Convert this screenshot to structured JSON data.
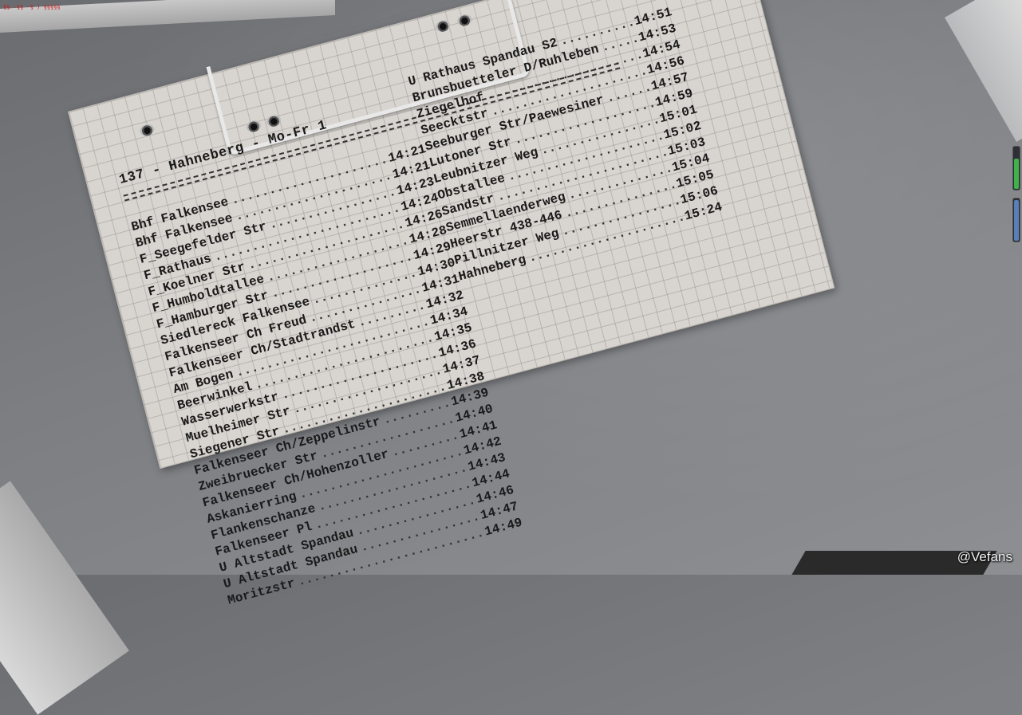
{
  "debug_text": "§§ -§§ -§ ) §§§§§",
  "watermark": "@Vefans",
  "timetable": {
    "header": "137 - Hahneberg - Mo-Fr 1",
    "left_stops": [
      {
        "name": "Bhf Falkensee",
        "time": "14:21"
      },
      {
        "name": "Bhf Falkensee",
        "time": "14:21"
      },
      {
        "name": "F_Seegefelder Str",
        "time": "14:23"
      },
      {
        "name": "F_Rathaus",
        "time": "14:24"
      },
      {
        "name": "F_Koelner Str",
        "time": "14:26"
      },
      {
        "name": "F_Humboldtallee",
        "time": "14:28"
      },
      {
        "name": "F_Hamburger Str",
        "time": "14:29"
      },
      {
        "name": "Siedlereck Falkensee",
        "time": "14:30"
      },
      {
        "name": "Falkenseer Ch Freud",
        "time": "14:31"
      },
      {
        "name": "Falkenseer Ch/Stadtrandst",
        "time": "14:32"
      },
      {
        "name": "Am Bogen",
        "time": "14:34"
      },
      {
        "name": "Beerwinkel",
        "time": "14:35"
      },
      {
        "name": "Wasserwerkstr",
        "time": "14:36"
      },
      {
        "name": "Muelheimer Str",
        "time": "14:37"
      },
      {
        "name": "Siegener Str",
        "time": "14:38"
      },
      {
        "name": "Falkenseer Ch/Zeppelinstr",
        "time": "14:39"
      },
      {
        "name": "Zweibruecker Str",
        "time": "14:40"
      },
      {
        "name": "Falkenseer Ch/Hohenzoller",
        "time": "14:41"
      },
      {
        "name": "Askanierring",
        "time": "14:42"
      },
      {
        "name": "Flankenschanze",
        "time": "14:43"
      },
      {
        "name": "Falkenseer Pl",
        "time": "14:44"
      },
      {
        "name": "U Altstadt Spandau",
        "time": "14:46"
      },
      {
        "name": "U Altstadt Spandau",
        "time": "14:47"
      },
      {
        "name": "Moritzstr",
        "time": "14:49"
      }
    ],
    "right_stops": [
      {
        "name": "U Rathaus Spandau S2",
        "time": "14:51"
      },
      {
        "name": "Brunsbuetteler D/Ruhleben",
        "time": "14:53"
      },
      {
        "name": "Ziegelhof",
        "time": "14:54"
      },
      {
        "name": "Seecktstr",
        "time": "14:56"
      },
      {
        "name": "Seeburger Str/Paewesiner",
        "time": "14:57"
      },
      {
        "name": "Lutoner Str",
        "time": "14:59"
      },
      {
        "name": "Leubnitzer Weg",
        "time": "15:01"
      },
      {
        "name": "Obstallee",
        "time": "15:02"
      },
      {
        "name": "Sandstr",
        "time": "15:03"
      },
      {
        "name": "Semmellaenderweg",
        "time": "15:04"
      },
      {
        "name": "Heerstr 438-446",
        "time": "15:05"
      },
      {
        "name": "Pillnitzer Weg",
        "time": "15:06"
      },
      {
        "name": "Hahneberg",
        "time": "15:24"
      }
    ]
  },
  "gauges": {
    "upper_color": "#3fb24a",
    "upper_level": 0.7,
    "lower_color": "#5a7fb8",
    "lower_level": 0.95
  }
}
